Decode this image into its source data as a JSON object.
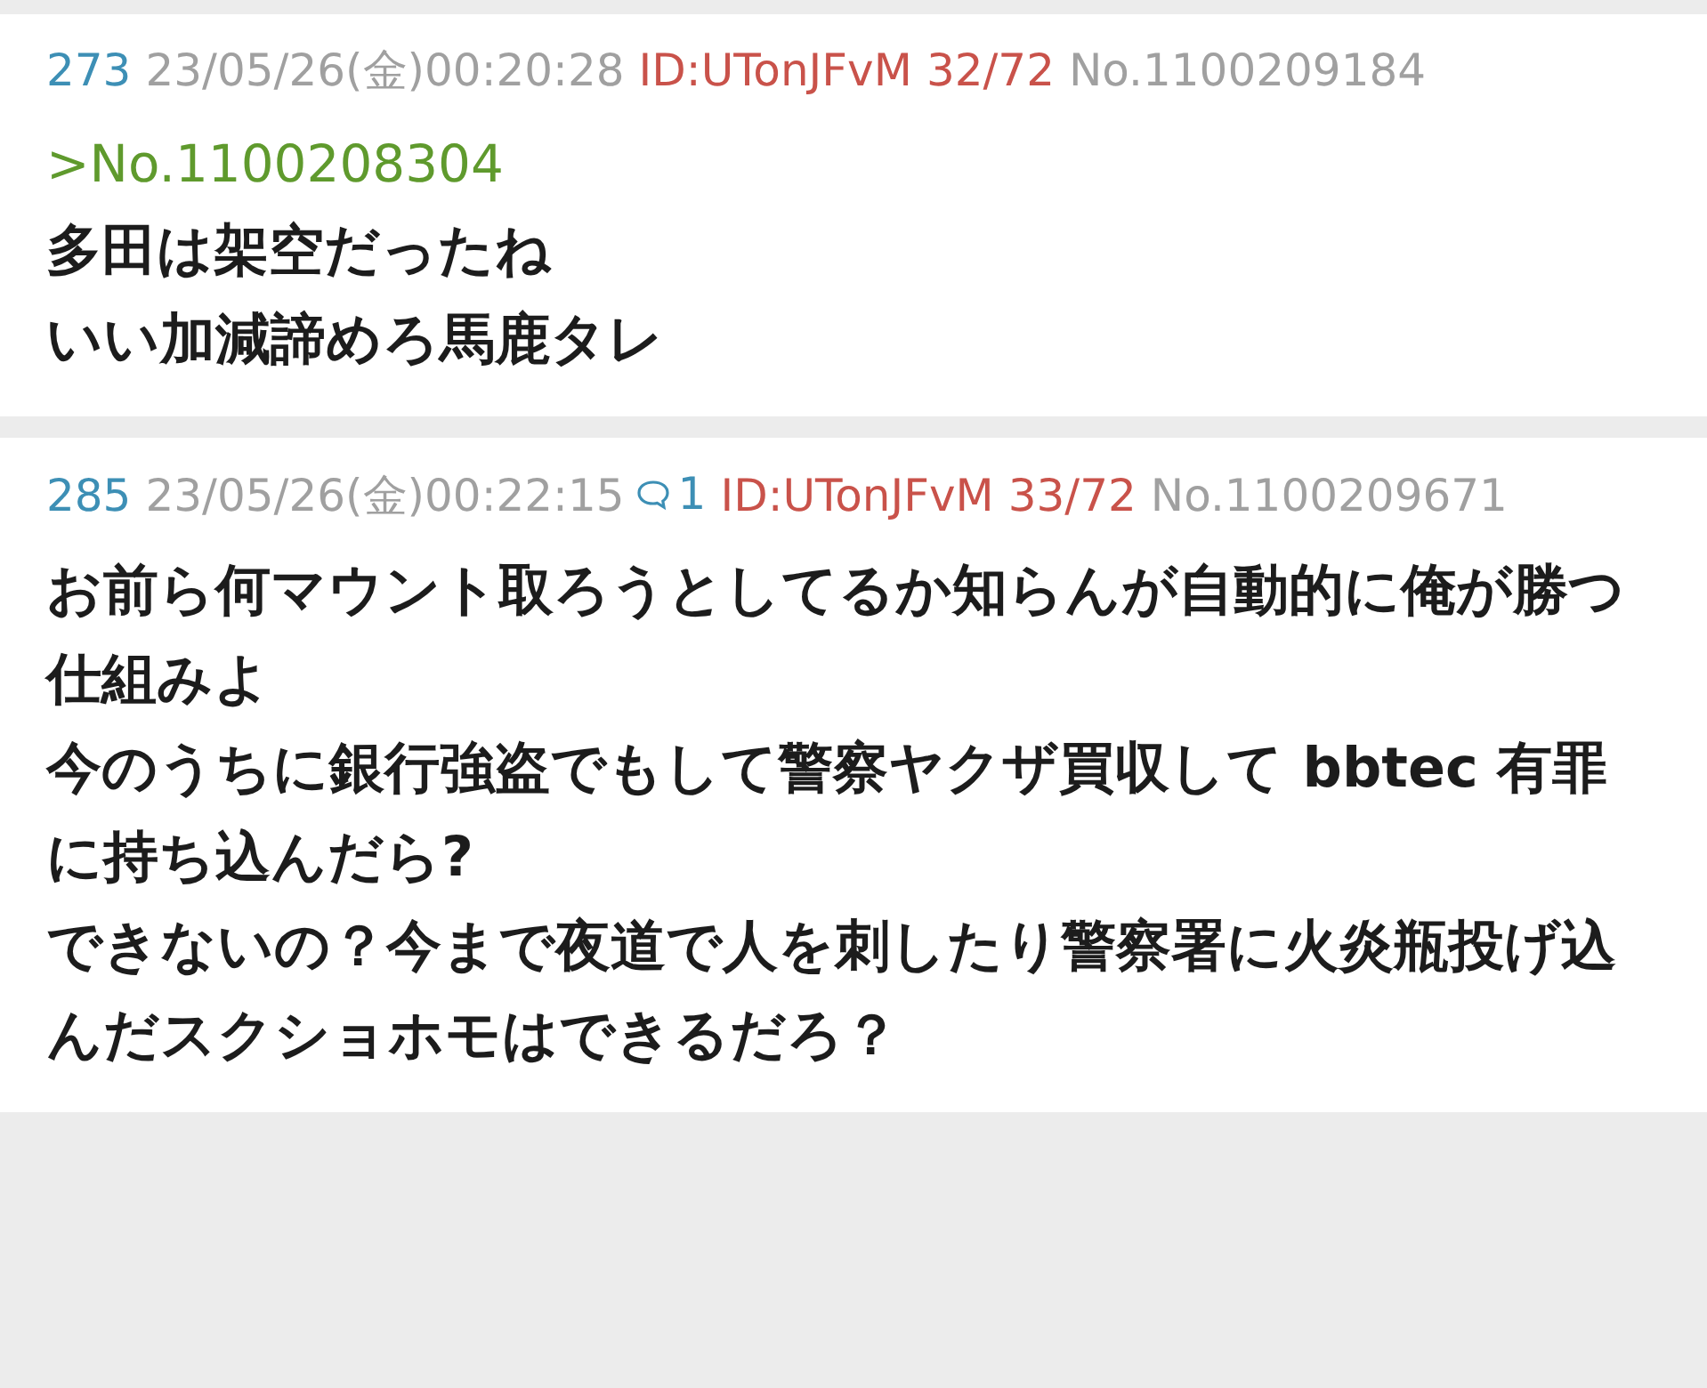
{
  "posts": [
    {
      "number": "273",
      "date": "23/05/26(金)00:20:28",
      "id": "ID:UTonJFvM",
      "id_count": "32/72",
      "no": "No.1100209184",
      "quote": ">No.1100208304",
      "paragraphs": [
        "多田は架空だったね",
        "いい加減諦めろ馬鹿タレ"
      ]
    },
    {
      "number": "285",
      "date": "23/05/26(金)00:22:15",
      "replies": "1",
      "id": "ID:UTonJFvM",
      "id_count": "33/72",
      "no": "No.1100209671",
      "paragraphs": [
        "お前ら何マウント取ろうとしてるか知らんが自動的に俺が勝つ仕組みよ",
        "今のうちに銀行強盗でもして警察ヤクザ買収して bbtec 有罪に持ち込んだら?",
        "できないの？今まで夜道で人を刺したり警察署に火炎瓶投げ込んだスクショホモはできるだろ？"
      ]
    }
  ]
}
